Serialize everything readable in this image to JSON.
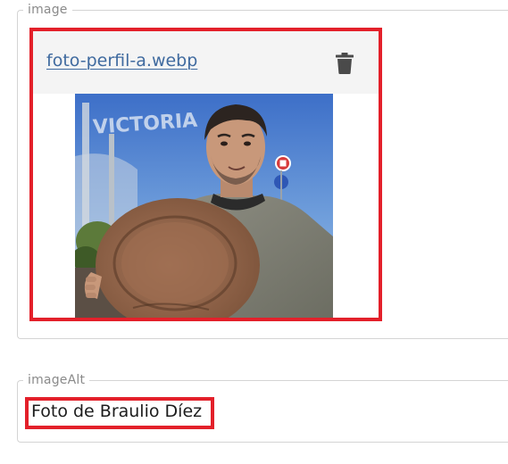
{
  "image_field": {
    "legend": "image",
    "file_name": "foto-perfil-a.webp",
    "delete_icon": "trash-icon",
    "photo_alt": "Foto de Braulio Díez",
    "photo_sign_text": "VICTORIA"
  },
  "alt_field": {
    "legend": "imageAlt",
    "value": "Foto de Braulio Díez"
  },
  "colors": {
    "highlight": "#e3202a",
    "link": "#3f6a9f",
    "legend": "#8a8a8a",
    "header_bg": "#f4f4f4"
  }
}
